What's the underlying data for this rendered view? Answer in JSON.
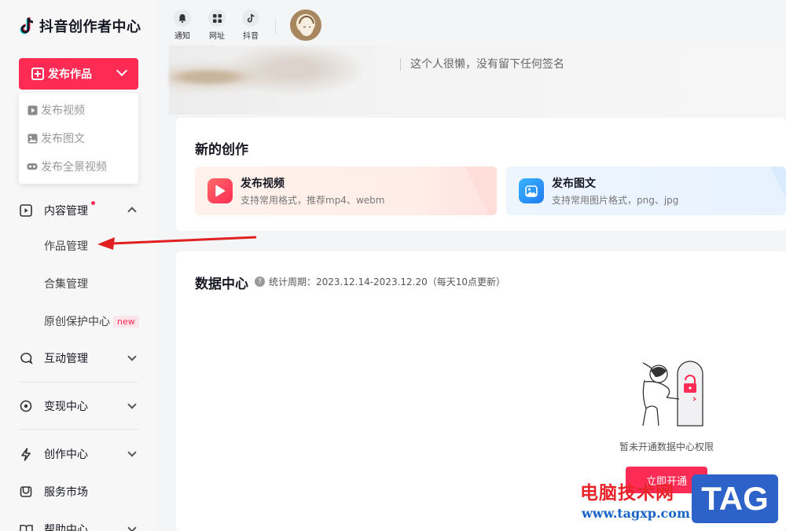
{
  "app": {
    "title": "抖音创作者中心"
  },
  "sidebar": {
    "publish_button": "发布作品",
    "publish_menu": [
      {
        "label": "发布视频",
        "icon": "video-icon"
      },
      {
        "label": "发布图文",
        "icon": "image-icon"
      },
      {
        "label": "发布全景视频",
        "icon": "vr-icon"
      }
    ],
    "content_management": {
      "label": "内容管理",
      "expanded": true,
      "has_dot": true,
      "children": [
        {
          "label": "作品管理"
        },
        {
          "label": "合集管理"
        },
        {
          "label": "原创保护中心",
          "badge": "new"
        }
      ]
    },
    "groups": [
      {
        "label": "互动管理",
        "icon": "chat-icon"
      },
      {
        "label": "变现中心",
        "icon": "monetize-icon"
      },
      {
        "label": "创作中心",
        "icon": "lightning-icon"
      },
      {
        "label": "服务市场",
        "icon": "market-icon"
      },
      {
        "label": "帮助中心",
        "icon": "book-icon"
      }
    ]
  },
  "topbar": {
    "items": [
      {
        "label": "通知",
        "icon": "bell-icon"
      },
      {
        "label": "网址",
        "icon": "grid-icon"
      },
      {
        "label": "抖音",
        "icon": "douyin-icon"
      }
    ]
  },
  "profile": {
    "signature": "这个人很懒，没有留下任何签名"
  },
  "new_creation": {
    "title": "新的创作",
    "tiles": [
      {
        "title": "发布视频",
        "desc": "支持常用格式，推荐mp4、webm"
      },
      {
        "title": "发布图文",
        "desc": "支持常用图片格式，png、jpg"
      }
    ]
  },
  "data_center": {
    "title": "数据中心",
    "period": "统计周期：2023.12.14-2023.12.20（每天10点更新）",
    "empty_text": "暂未开通数据中心权限",
    "open_button": "立即开通"
  },
  "watermark": {
    "text": "电脑技术网",
    "url": "www.tagxp.com",
    "tag": "TAG"
  },
  "colors": {
    "accent": "#fe2c55",
    "watermark_blue": "#2d62c9"
  }
}
